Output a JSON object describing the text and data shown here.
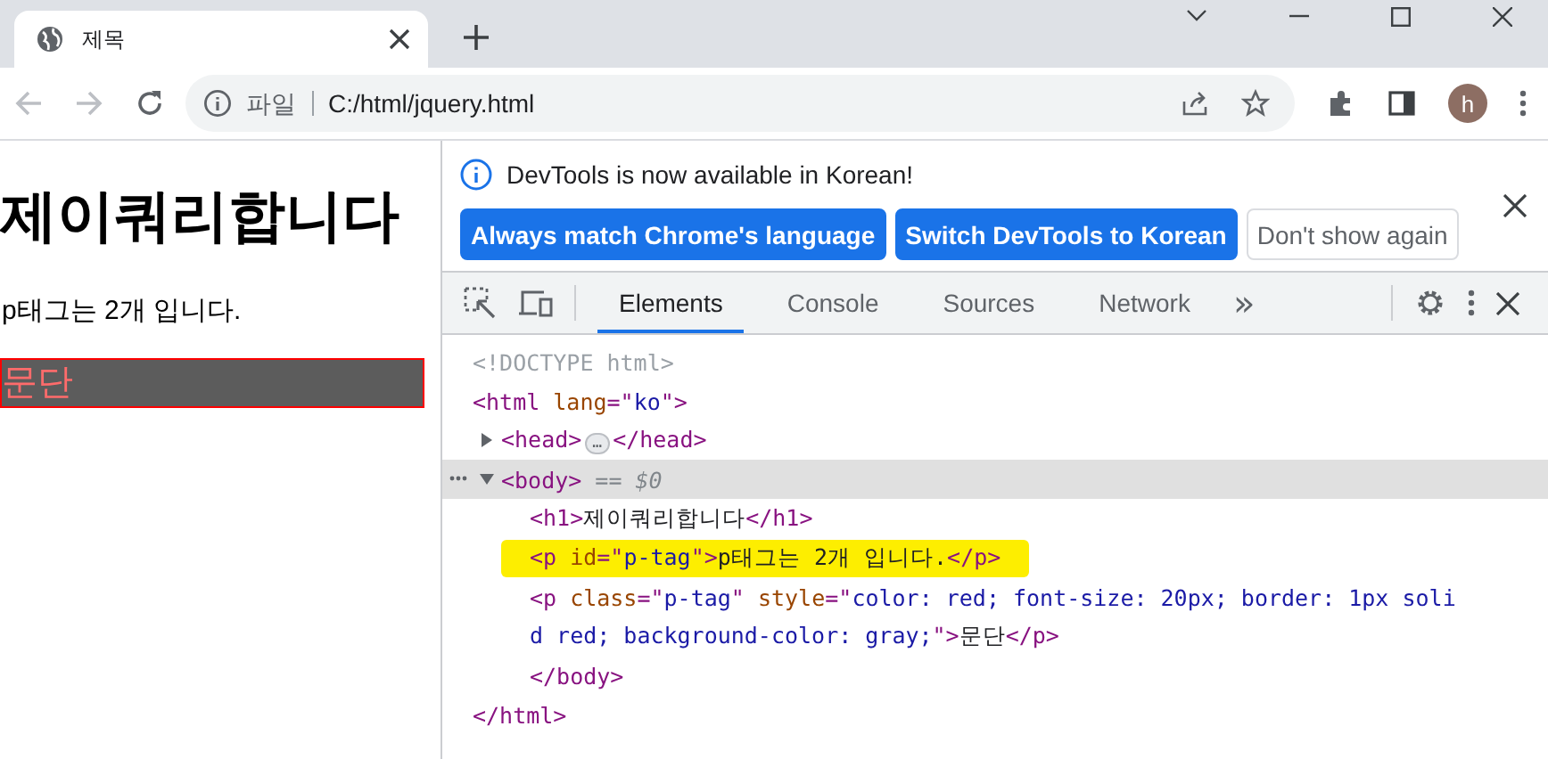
{
  "browser": {
    "tabs": [
      {
        "title": "제목",
        "selected": true
      }
    ],
    "address": {
      "scheme_label": "파일",
      "url": "C:/html/jquery.html"
    },
    "profile_initial": "h"
  },
  "page": {
    "heading": "제이쿼리합니다",
    "paragraph": "p태그는 2개 입니다.",
    "boxed_paragraph": "문단"
  },
  "devtools": {
    "infobar": {
      "message": "DevTools is now available in Korean!",
      "buttons": [
        {
          "label": "Always match Chrome's language",
          "kind": "primary"
        },
        {
          "label": "Switch DevTools to Korean",
          "kind": "primary"
        },
        {
          "label": "Don't show again",
          "kind": "secondary"
        }
      ]
    },
    "tabs": [
      {
        "label": "Elements",
        "selected": true
      },
      {
        "label": "Console",
        "selected": false
      },
      {
        "label": "Sources",
        "selected": false
      },
      {
        "label": "Network",
        "selected": false
      }
    ],
    "more_tabs": "»",
    "dom": [
      {
        "lines": [
          [
            {
              "kind": "doctype",
              "text": "<!DOCTYPE html>"
            }
          ]
        ]
      },
      {
        "lines": [
          [
            {
              "kind": "tag",
              "text": "<html "
            },
            {
              "kind": "attr",
              "text": "lang"
            },
            {
              "kind": "tag",
              "text": "=\""
            },
            {
              "kind": "value",
              "text": "ko"
            },
            {
              "kind": "tag",
              "text": "\">"
            }
          ]
        ],
        "children": [
          {
            "expanded": false,
            "lines": [
              [
                {
                  "kind": "tag",
                  "text": "<head>"
                },
                {
                  "kind": "ellipsis",
                  "text": "…"
                },
                {
                  "kind": "tag",
                  "text": "</head>"
                }
              ]
            ]
          },
          {
            "expanded": true,
            "selected": true,
            "lines": [
              [
                {
                  "kind": "tag",
                  "text": "<body>"
                },
                {
                  "kind": "note",
                  "text": " == $0"
                }
              ]
            ],
            "children": [
              {
                "lines": [
                  [
                    {
                      "kind": "tag",
                      "text": "<h1>"
                    },
                    {
                      "kind": "text",
                      "text": "제이쿼리합니다"
                    },
                    {
                      "kind": "tag",
                      "text": "</h1>"
                    }
                  ]
                ]
              },
              {
                "highlighted": true,
                "lines": [
                  [
                    {
                      "kind": "tag",
                      "text": "<p "
                    },
                    {
                      "kind": "attr",
                      "text": "id"
                    },
                    {
                      "kind": "tag",
                      "text": "=\""
                    },
                    {
                      "kind": "value",
                      "text": "p-tag"
                    },
                    {
                      "kind": "tag",
                      "text": "\">"
                    },
                    {
                      "kind": "text",
                      "text": "p태그는 2개 입니다."
                    },
                    {
                      "kind": "tag",
                      "text": "</p>"
                    }
                  ]
                ]
              },
              {
                "lines": [
                  [
                    {
                      "kind": "tag",
                      "text": "<p "
                    },
                    {
                      "kind": "attr",
                      "text": "class"
                    },
                    {
                      "kind": "tag",
                      "text": "=\""
                    },
                    {
                      "kind": "value",
                      "text": "p-tag"
                    },
                    {
                      "kind": "tag",
                      "text": "\" "
                    },
                    {
                      "kind": "attr",
                      "text": "style"
                    },
                    {
                      "kind": "tag",
                      "text": "=\""
                    },
                    {
                      "kind": "value",
                      "text": "color: red; font-size: 20px; border: 1px soli"
                    }
                  ],
                  [
                    {
                      "kind": "value",
                      "text": "d red; background-color: gray;"
                    },
                    {
                      "kind": "tag",
                      "text": "\">"
                    },
                    {
                      "kind": "text",
                      "text": "문단"
                    },
                    {
                      "kind": "tag",
                      "text": "</p>"
                    }
                  ]
                ]
              },
              {
                "lines": [
                  [
                    {
                      "kind": "tag",
                      "text": "</body>"
                    }
                  ]
                ]
              }
            ]
          }
        ]
      },
      {
        "lines": [
          [
            {
              "kind": "tag",
              "text": "</html>"
            }
          ]
        ]
      }
    ]
  }
}
